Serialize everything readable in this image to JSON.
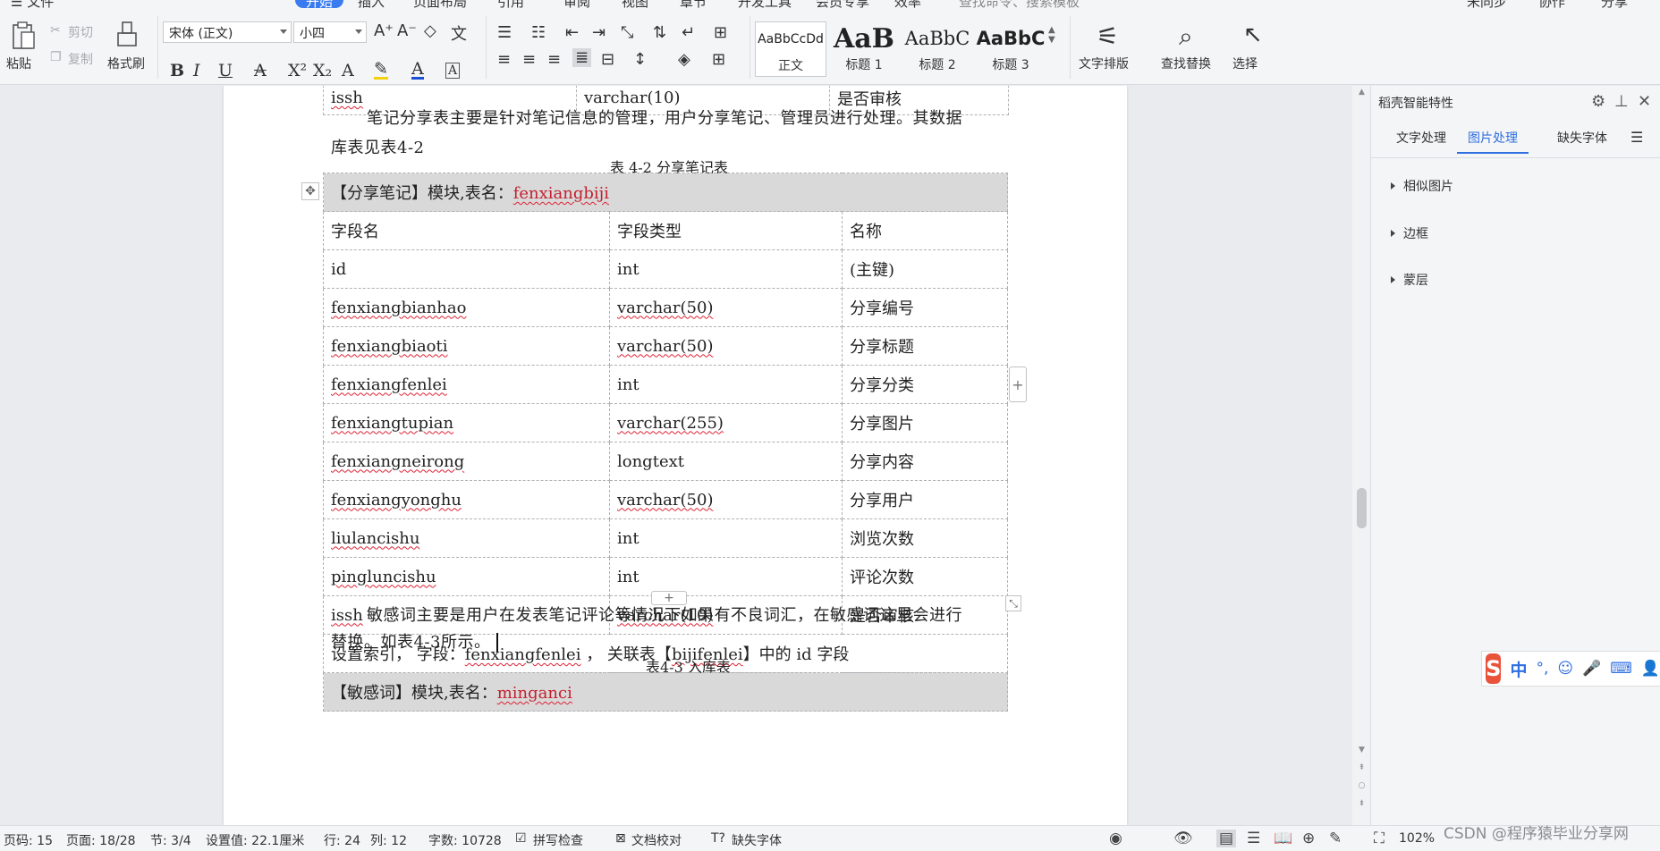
{
  "menu": {
    "items": [
      "☰ 文件",
      "开始",
      "插入",
      "页面布局",
      "引用",
      "审阅",
      "视图",
      "章节",
      "开发工具",
      "会员专享",
      "效率"
    ],
    "search_placeholder": "查找命令、搜索模板",
    "right": [
      "未同步",
      "协作",
      "分享"
    ]
  },
  "ribbon": {
    "paste": "粘贴",
    "cut": "剪切",
    "copy": "复制",
    "format_painter": "格式刷",
    "font_name": "宋体 (正文)",
    "font_size": "小四",
    "styles": [
      {
        "preview": "AaBbCcDd",
        "label": "正文"
      },
      {
        "preview": "AaB",
        "label": "标题 1"
      },
      {
        "preview": "AaBbC",
        "label": "标题 2"
      },
      {
        "preview": "AaBbC",
        "label": "标题 3"
      }
    ],
    "text_layout": "文字排版",
    "find_replace": "查找替换",
    "select": "选择"
  },
  "document": {
    "top_row": {
      "field": "issh",
      "type": "varchar(10)",
      "name": "是否审核"
    },
    "para1_line1": "笔记分享表主要是针对笔记信息的管理，用户分享笔记、管理员进行处理。其数据",
    "para1_line2": "库表见表4-2",
    "table2_caption": "表 4-2  分享笔记表",
    "table2_header_prefix": "【分享笔记】模块,表名：",
    "table2_header_name": "fenxiangbiji",
    "table2_columns": [
      "字段名",
      "字段类型",
      "名称"
    ],
    "table2_rows": [
      {
        "field": "id",
        "type": "int",
        "name": "(主键)"
      },
      {
        "field": "fenxiangbianhao",
        "type": "varchar(50)",
        "name": "分享编号"
      },
      {
        "field": "fenxiangbiaoti",
        "type": "varchar(50)",
        "name": "分享标题"
      },
      {
        "field": "fenxiangfenlei",
        "type": "int",
        "name": "分享分类"
      },
      {
        "field": "fenxiangtupian",
        "type": "varchar(255)",
        "name": "分享图片"
      },
      {
        "field": "fenxiangneirong",
        "type": "longtext",
        "name": "分享内容"
      },
      {
        "field": "fenxiangyonghu",
        "type": "varchar(50)",
        "name": "分享用户"
      },
      {
        "field": "liulancishu",
        "type": "int",
        "name": "浏览次数"
      },
      {
        "field": "pingluncishu",
        "type": "int",
        "name": "评论次数"
      },
      {
        "field": "issh",
        "type": "varchar(10)",
        "name": "是否审核"
      }
    ],
    "table2_index": {
      "prefix": "设置索引，  字段：",
      "field": "fenxiangfenlei",
      "mid": " ，  关联表【",
      "table": "bijifenlei",
      "suffix": "】中的 id  字段"
    },
    "para2_line1": "敏感词主要是用户在发表笔记评论等情况下如果有不良词汇，在敏感词这里会进行",
    "para2_line2": "替换。如表4-3所示。",
    "table3_caption": "表4-3  入库表",
    "table3_header_prefix": "【敏感词】模块,表名：",
    "table3_header_name": "minganci"
  },
  "panel": {
    "title": "稻壳智能特性",
    "tabs": [
      "文字处理",
      "图片处理",
      "缺失字体"
    ],
    "active_tab": "图片处理",
    "sections": [
      "相似图片",
      "边框",
      "蒙层"
    ]
  },
  "status": {
    "page_no": "页码: 15",
    "pages": "页面: 18/28",
    "section": "节: 3/4",
    "setting": "设置值: 22.1厘米",
    "row": "行: 24",
    "col": "列: 12",
    "words": "字数: 10728",
    "spell": "拼写检查",
    "proof": "文档校对",
    "missing_font": "缺失字体",
    "zoom": "102%"
  },
  "watermark": "CSDN @程序猿毕业分享网",
  "colors": {
    "accent": "#2f6fe0",
    "error_red": "#c3202f",
    "table_header": "#d9d9d9"
  }
}
